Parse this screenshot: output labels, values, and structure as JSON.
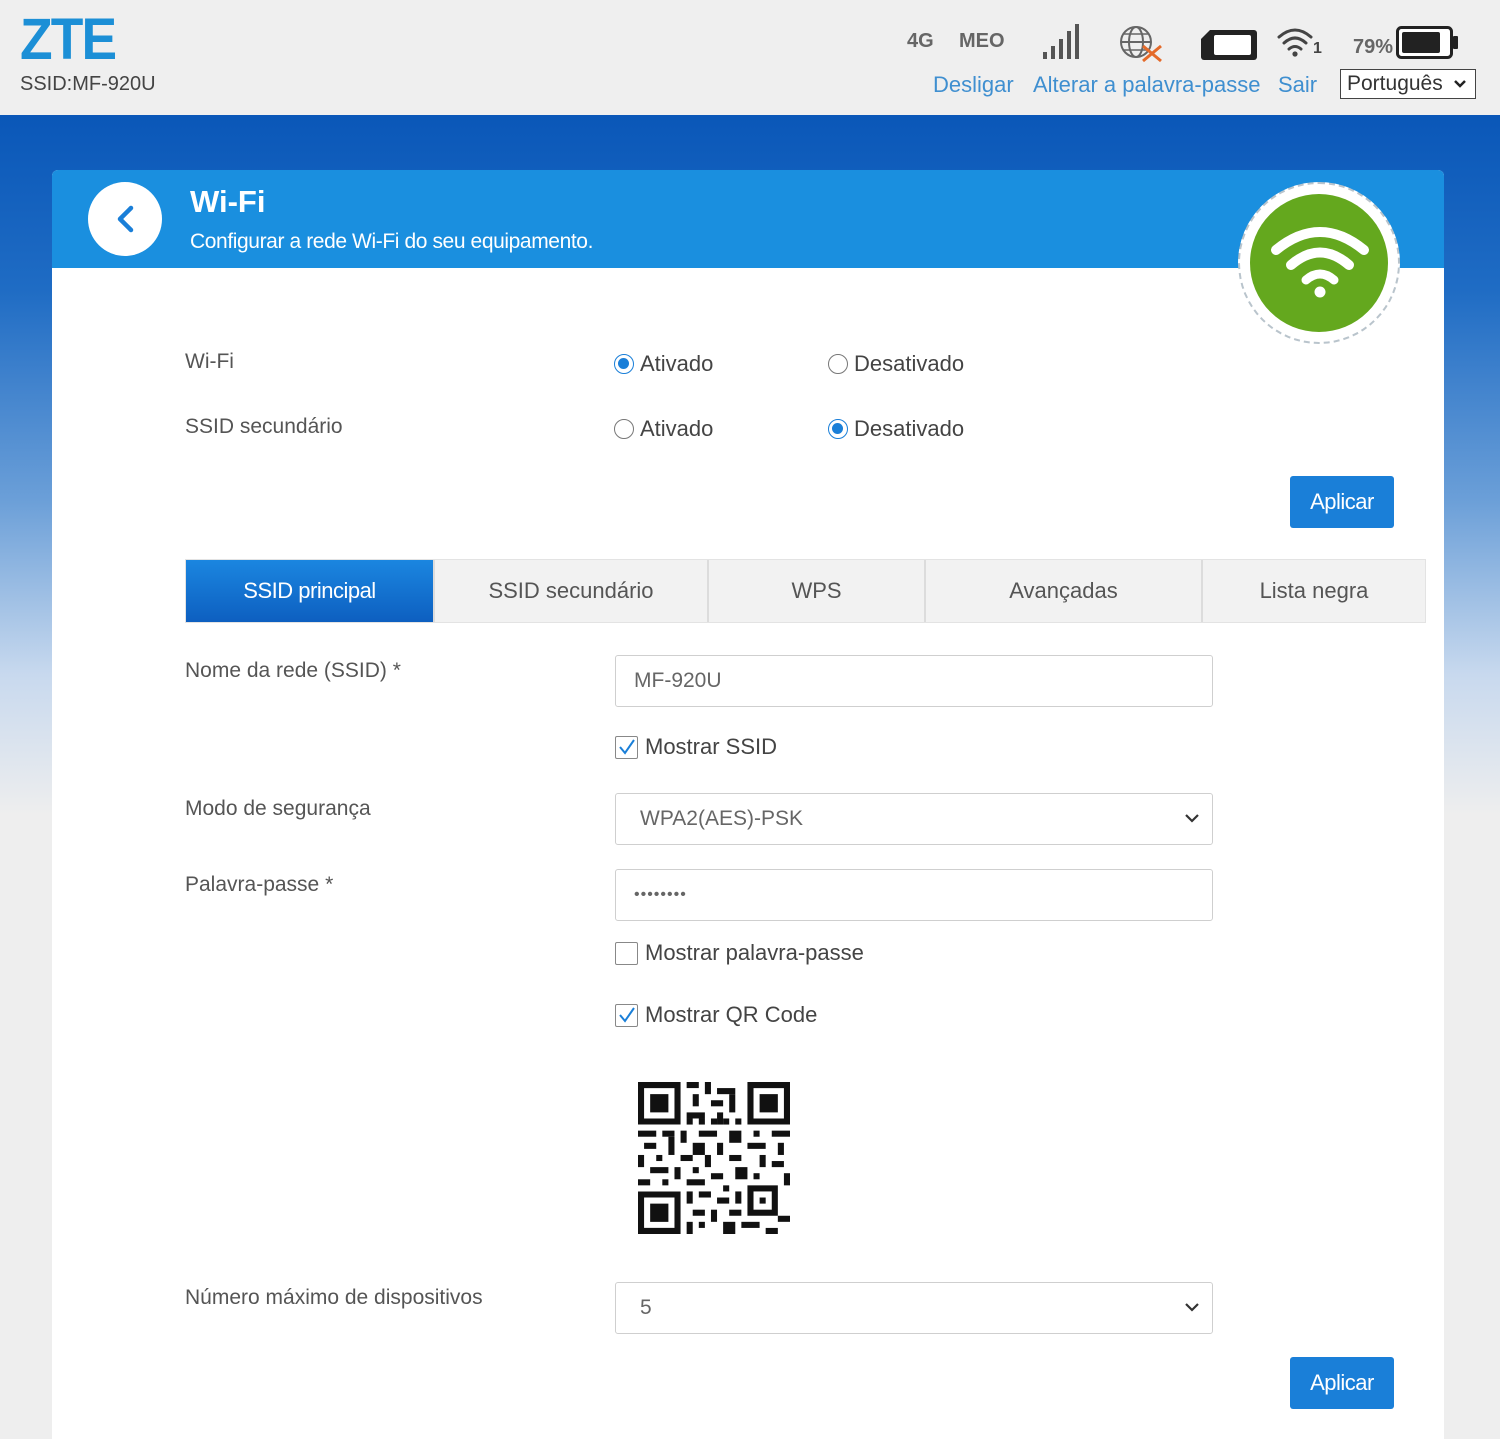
{
  "header": {
    "logo": "ZTE",
    "ssid": "SSID:MF-920U",
    "network_type": "4G",
    "operator": "MEO",
    "wifi_clients": "1",
    "battery": "79%",
    "links": {
      "disconnect": "Desligar",
      "change_password": "Alterar a palavra-passe",
      "logout": "Sair"
    },
    "language": "Português"
  },
  "panel": {
    "title": "Wi-Fi",
    "subtitle": "Configurar a rede Wi-Fi do seu equipamento.",
    "wifi": {
      "label": "Wi-Fi",
      "on_label": "Ativado",
      "off_label": "Desativado",
      "value": "on"
    },
    "secondary_ssid": {
      "label": "SSID secundário",
      "on_label": "Ativado",
      "off_label": "Desativado",
      "value": "off"
    },
    "apply_label": "Aplicar",
    "tabs": [
      {
        "label": "SSID principal",
        "active": true
      },
      {
        "label": "SSID secundário",
        "active": false
      },
      {
        "label": "WPS",
        "active": false
      },
      {
        "label": "Avançadas",
        "active": false
      },
      {
        "label": "Lista negra",
        "active": false
      }
    ],
    "form": {
      "ssid_label": "Nome da rede (SSID) *",
      "ssid_value": "MF-920U",
      "show_ssid_label": "Mostrar SSID",
      "show_ssid_checked": true,
      "security_label": "Modo de segurança",
      "security_value": "WPA2(AES)-PSK",
      "password_label": "Palavra-passe *",
      "password_value": "••••••••",
      "show_password_label": "Mostrar palavra-passe",
      "show_password_checked": false,
      "show_qr_label": "Mostrar QR Code",
      "show_qr_checked": true,
      "max_devices_label": "Número máximo de dispositivos",
      "max_devices_value": "5"
    },
    "apply_label_2": "Aplicar"
  },
  "colors": {
    "brand_blue": "#1c8fd6",
    "header_blue": "#1a8fdf",
    "button_blue": "#1a7fd8",
    "wifi_green": "#64a81e",
    "link_blue": "#3f8fd0"
  }
}
